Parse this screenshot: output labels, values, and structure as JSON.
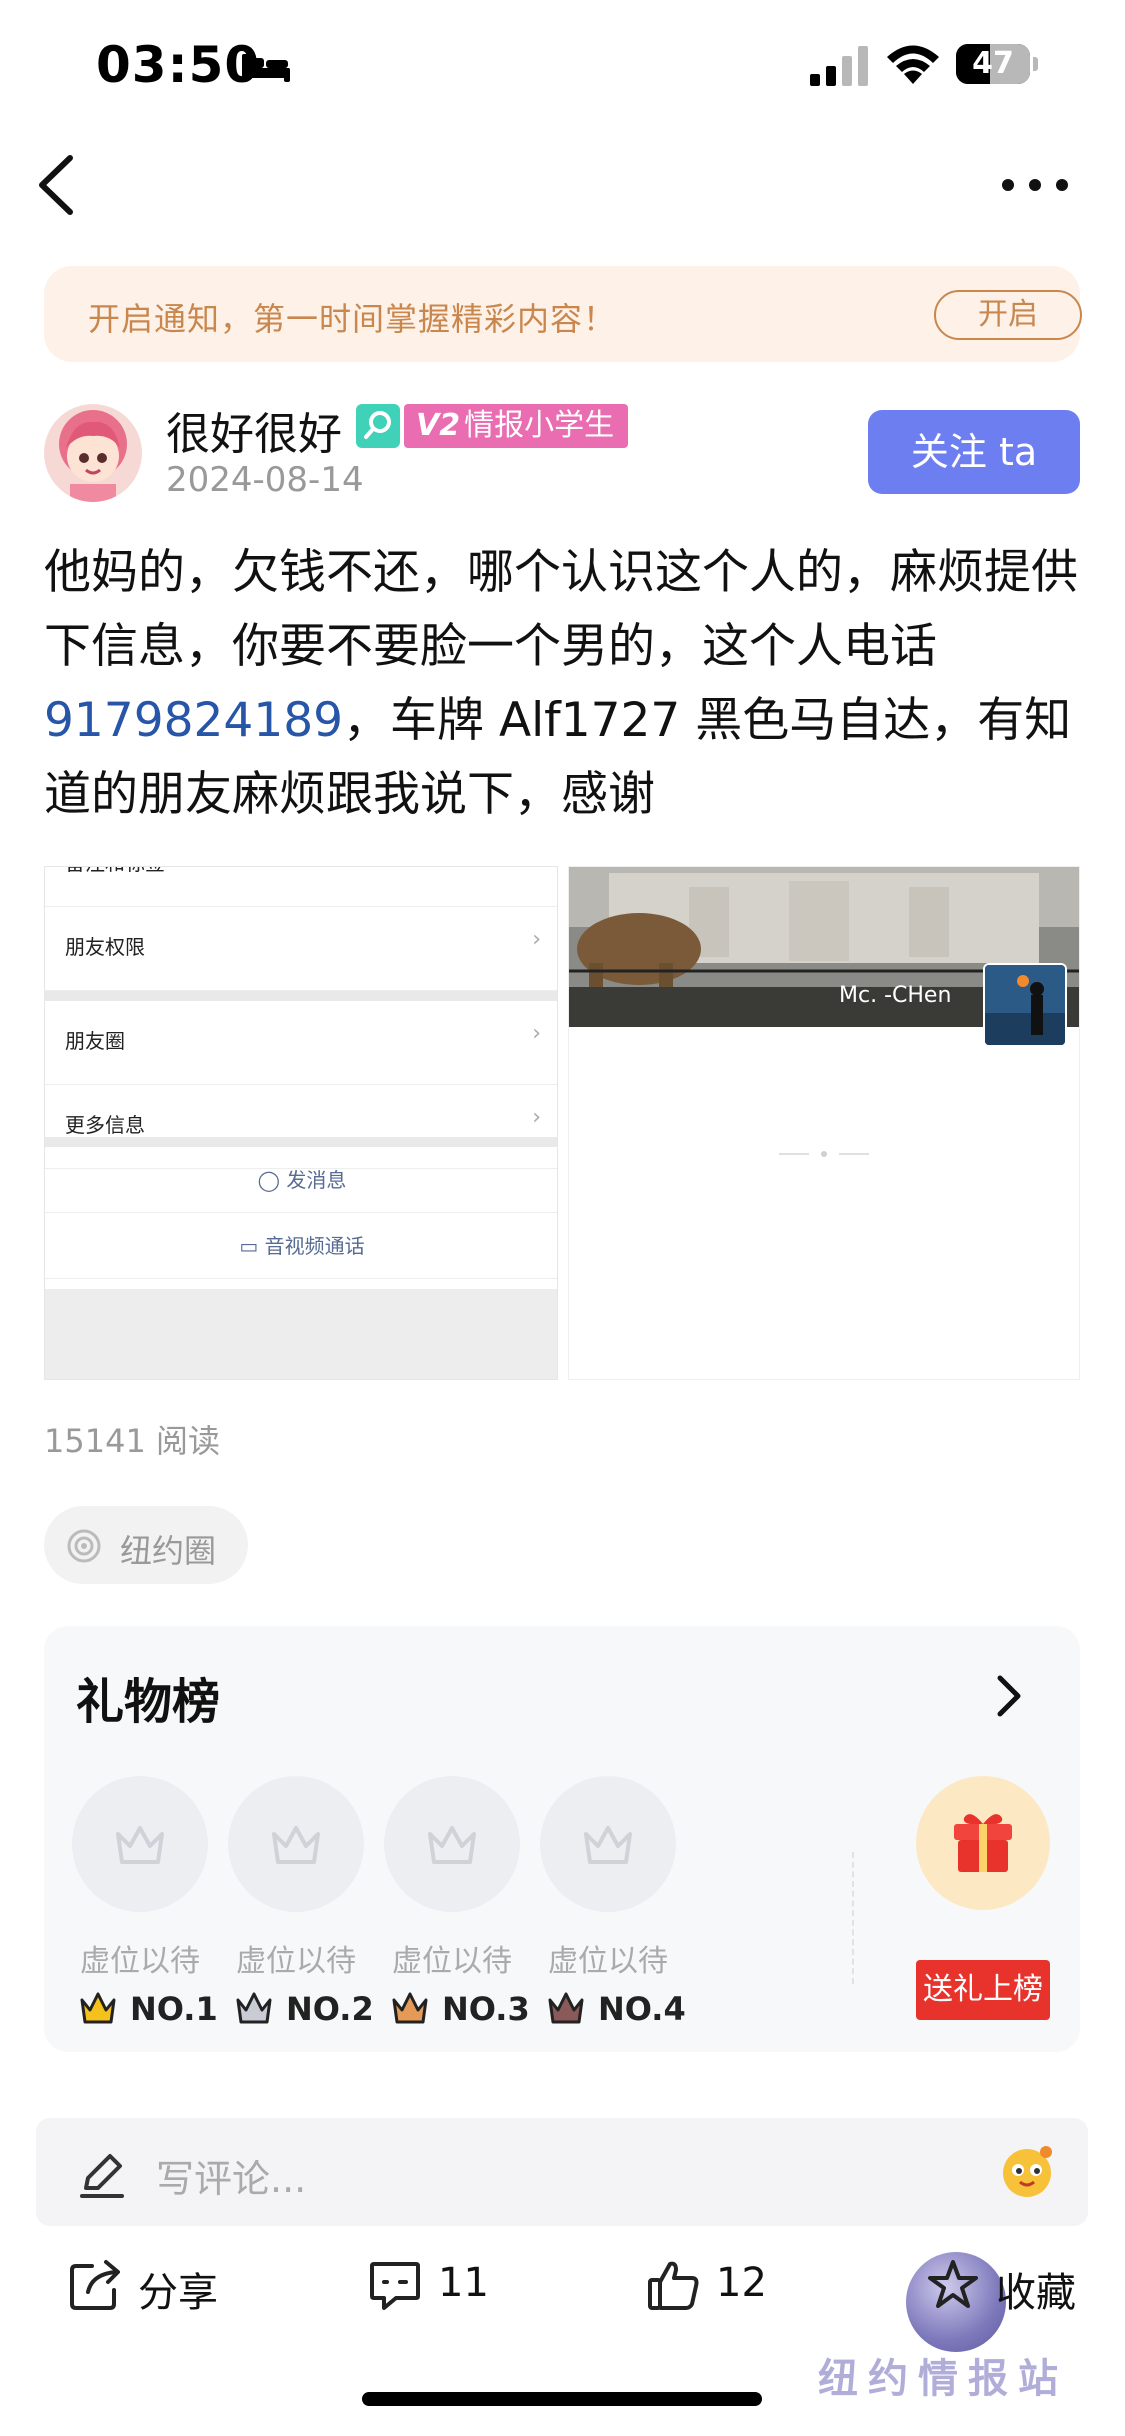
{
  "status_bar": {
    "time": "03:50",
    "battery": "47"
  },
  "notice": {
    "text": "开启通知，第一时间掌握精彩内容！",
    "button": "开启"
  },
  "author": {
    "name": "很好很好",
    "badge_level_prefix": "V2",
    "badge_level": "情报小学生",
    "date": "2024-08-14",
    "follow_label": "关注 ta"
  },
  "post": {
    "text_before_phone": "他妈的，欠钱不还，哪个认识这个人的，麻烦提供下信息，你要不要脸一个男的，这个人电话 ",
    "phone": "9179824189",
    "text_after_phone": "，车牌 Alf1727 黑色马自达，有知道的朋友麻烦跟我说下，感谢"
  },
  "screenshot_left": {
    "rows": [
      "备注和标签",
      "朋友权限",
      "朋友圈",
      "更多信息"
    ],
    "send_message": "发消息",
    "video_call": "音视频通话"
  },
  "screenshot_right": {
    "name": "Mc.  -CHen"
  },
  "read_count": "15141 阅读",
  "tag": {
    "label": "纽约圈"
  },
  "gift_board": {
    "title": "礼物榜",
    "seats": [
      {
        "label": "虚位以待",
        "rank": "NO.1",
        "crown_color": "#f4c21a"
      },
      {
        "label": "虚位以待",
        "rank": "NO.2",
        "crown_color": "#c9ccd4"
      },
      {
        "label": "虚位以待",
        "rank": "NO.3",
        "crown_color": "#e59a57"
      },
      {
        "label": "虚位以待",
        "rank": "NO.4",
        "crown_color": "#8a5a5a"
      }
    ],
    "send_label": "送礼上榜"
  },
  "comment": {
    "placeholder": "写评论..."
  },
  "actions": {
    "share": "分享",
    "comments": "11",
    "likes": "12",
    "favorite": "收藏"
  },
  "watermark": "纽约情报站"
}
